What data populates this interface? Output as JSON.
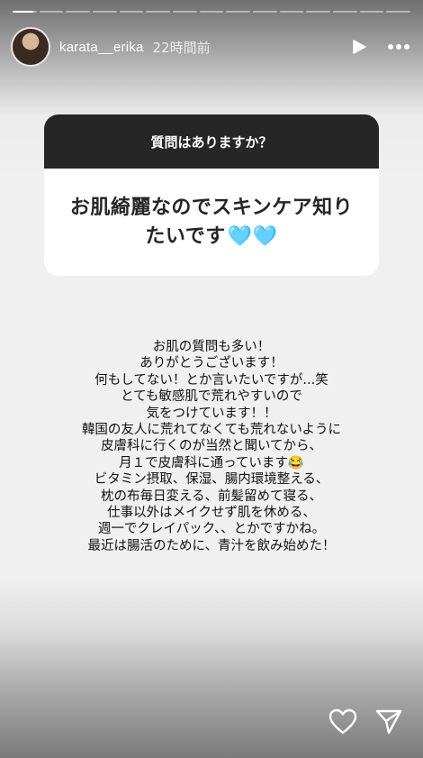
{
  "progress": {
    "segments": [
      0.85,
      0,
      0,
      0,
      0,
      0,
      0,
      0,
      0,
      0,
      0,
      0,
      0,
      0,
      0
    ]
  },
  "header": {
    "username": "karata__erika",
    "time": "22時間前"
  },
  "question_card": {
    "title": "質問はありますか？",
    "question": "お肌綺麗なのでスキンケア知りたいです",
    "emoji": "🩵🩵"
  },
  "answer": {
    "lines": [
      "お肌の質問も多い！",
      "ありがとうございます！",
      "何もしてない！とか言いたいですが...笑",
      "とても敏感肌で荒れやすいので",
      "気をつけています！！",
      "韓国の友人に荒れてなくても荒れないように",
      "皮膚科に行くのが当然と聞いてから、",
      "月１で皮膚科に通っています😂",
      "ビタミン摂取、保湿、腸内環境整える、",
      "枕の布毎日変える、前髪留めて寝る、",
      "仕事以外はメイクせず肌を休める、",
      "週一でクレイパック、、とかですかね。",
      "最近は腸活のために、青汁を飲み始めた！"
    ]
  },
  "icons": {
    "play": "play-icon",
    "more": "more-icon",
    "like": "heart-icon",
    "share": "send-icon"
  },
  "colors": {
    "card_header": "#262626",
    "card_body": "#ffffff",
    "text": "#111111"
  }
}
